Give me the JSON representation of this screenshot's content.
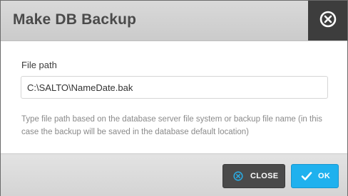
{
  "dialog": {
    "title": "Make DB Backup",
    "close_icon": "circle-x-icon"
  },
  "form": {
    "file_path_label": "File path",
    "file_path_value": "C:\\SALTO\\NameDate.bak",
    "help_text": "Type file path based on the database server file system or backup file name (in this case the backup will be saved in the database default location)"
  },
  "footer": {
    "close_label": "CLOSE",
    "close_icon": "circle-x-icon",
    "ok_label": "OK",
    "ok_icon": "checkmark-icon"
  },
  "colors": {
    "ok_button": "#1fb1ee",
    "close_button": "#4a4a4a",
    "title_close_bg": "#3d3d3d"
  }
}
